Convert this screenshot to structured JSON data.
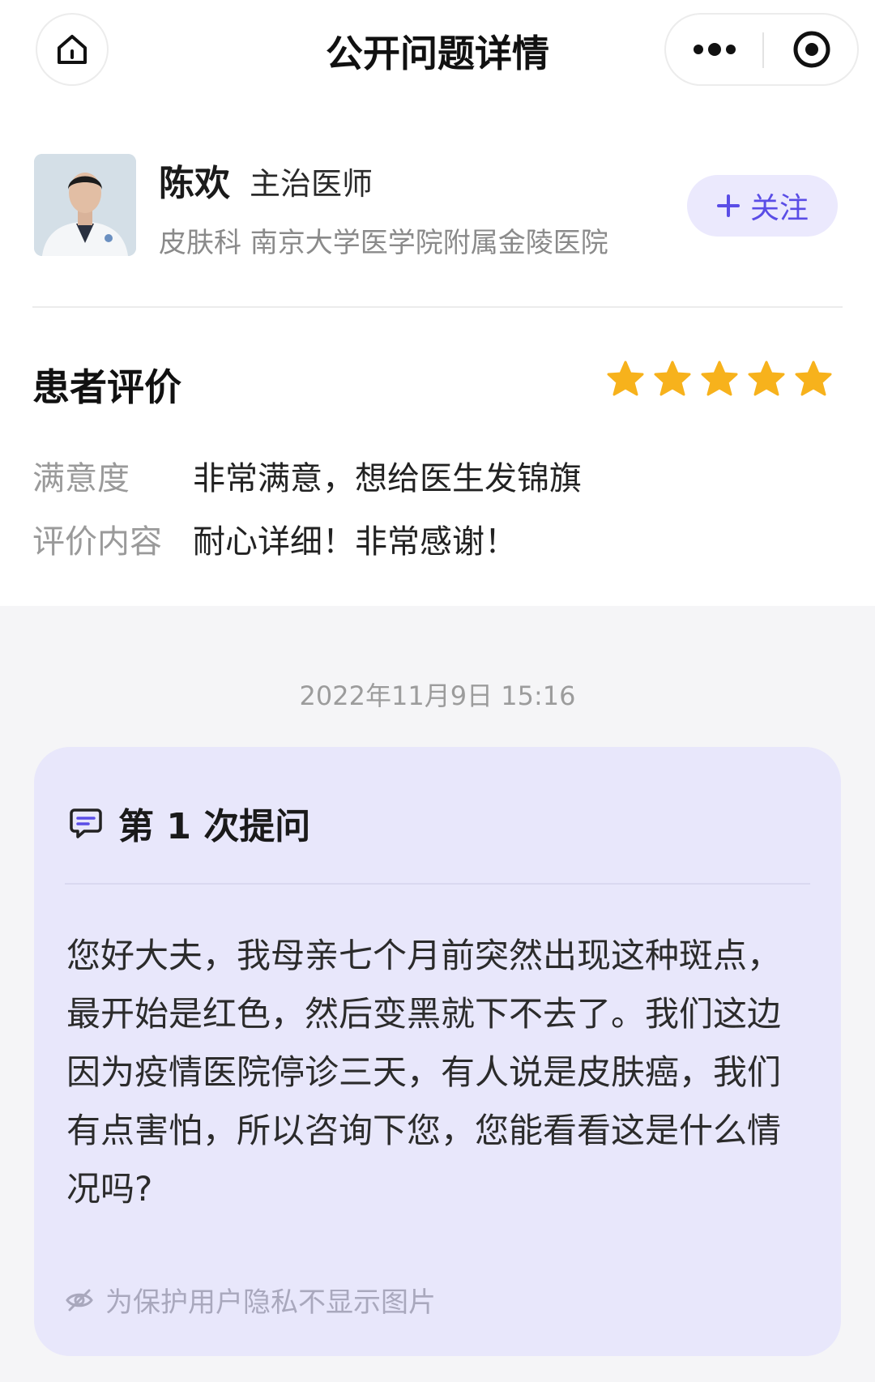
{
  "nav": {
    "title": "公开问题详情",
    "home_icon": "home-icon",
    "more_icon": "more-dots-icon",
    "close_icon": "target-close-icon"
  },
  "doctor": {
    "name": "陈欢",
    "title": "主治医师",
    "department": "皮肤科 南京大学医学院附属金陵医院",
    "follow_label": "关注",
    "follow_icon": "plus-icon"
  },
  "rating": {
    "title": "患者评价",
    "stars": 5,
    "star_color": "#f7b21c",
    "rows": [
      {
        "label": "满意度",
        "value": "非常满意，想给医生发锦旗"
      },
      {
        "label": "评价内容",
        "value": "耐心详细！非常感谢！"
      }
    ]
  },
  "timestamp": "2022年11月9日 15:16",
  "question": {
    "title": "第 1 次提问",
    "icon": "chat-bubble-icon",
    "text": "您好大夫，我母亲七个月前突然出现这种斑点，最开始是红色，然后变黑就下不去了。我们这边因为疫情医院停诊三天，有人说是皮肤癌，我们有点害怕，所以咨询下您，您能看看这是什么情况吗?",
    "privacy_note": "为保护用户隐私不显示图片",
    "privacy_icon": "eye-slash-icon"
  },
  "colors": {
    "accent": "#5a4de6",
    "follow_bg": "#ebe9fd",
    "card_bg": "#e8e7fb",
    "grey_bg": "#f5f5f7"
  }
}
